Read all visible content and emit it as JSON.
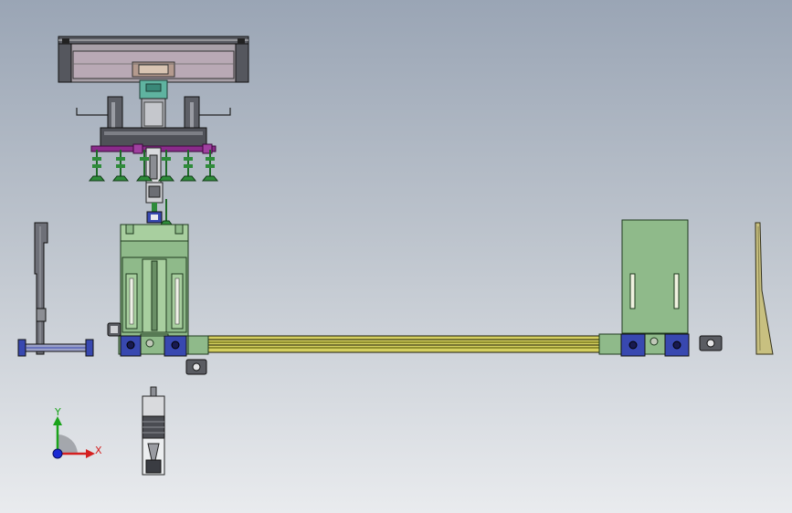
{
  "triad": {
    "y_label": "Y",
    "x_label": "X",
    "y_color": "#1aa31a",
    "x_color": "#d42020",
    "z_color": "#1a2ad4"
  },
  "colors": {
    "frame_gray": "#6e7078",
    "plate_green": "#8fba8a",
    "plate_green_light": "#a8cf9f",
    "cyan_block": "#5fb3a0",
    "blue_mount": "#3848b0",
    "rail_olive": "#7a7a1e",
    "cup_green": "#2e8b3a",
    "magenta": "#8a2a8a",
    "tan_arm": "#c8c080"
  },
  "components": [
    {
      "id": "gantry-beam",
      "icon": "aluminum-profile"
    },
    {
      "id": "suction-head",
      "icon": "vacuum-cups"
    },
    {
      "id": "lift-cylinder",
      "icon": "cylinder"
    },
    {
      "id": "left-module",
      "icon": "slide-table"
    },
    {
      "id": "right-module",
      "icon": "slide-table"
    },
    {
      "id": "linear-rail",
      "icon": "guide-rail"
    },
    {
      "id": "left-bracket",
      "icon": "l-bracket"
    },
    {
      "id": "right-arm",
      "icon": "tapered-arm"
    },
    {
      "id": "bottom-motor",
      "icon": "motor"
    }
  ]
}
